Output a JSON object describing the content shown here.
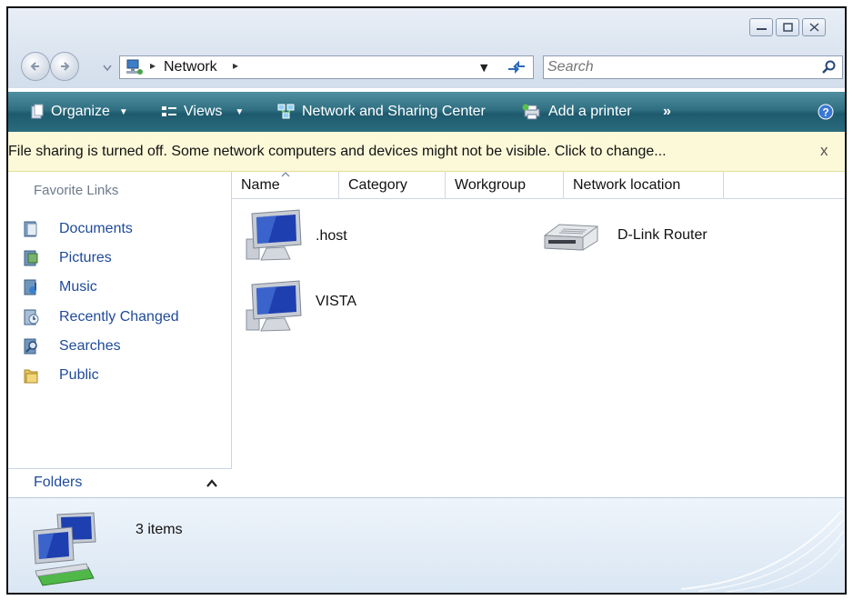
{
  "address": {
    "segment": "Network"
  },
  "search": {
    "placeholder": "Search"
  },
  "toolbar": {
    "organize": "Organize",
    "views": "Views",
    "network_center": "Network and Sharing Center",
    "add_printer": "Add a printer",
    "more": "»"
  },
  "infobar": {
    "message": "File sharing is turned off. Some network computers and devices might not be visible. Click to change...",
    "close": "x"
  },
  "left_pane": {
    "title": "Favorite Links",
    "links": [
      {
        "label": "Documents",
        "icon": "documents-icon"
      },
      {
        "label": "Pictures",
        "icon": "pictures-icon"
      },
      {
        "label": "Music",
        "icon": "music-icon"
      },
      {
        "label": "Recently Changed",
        "icon": "recently-changed-icon"
      },
      {
        "label": "Searches",
        "icon": "searches-icon"
      },
      {
        "label": "Public",
        "icon": "public-folder-icon"
      }
    ],
    "folders_label": "Folders"
  },
  "columns": [
    "Name",
    "Category",
    "Workgroup",
    "Network location"
  ],
  "items": [
    {
      "label": ".host",
      "icon": "computer-icon"
    },
    {
      "label": "D-Link Router",
      "icon": "router-icon"
    },
    {
      "label": "VISTA",
      "icon": "computer-icon"
    }
  ],
  "details": {
    "count": "3 items"
  },
  "colors": {
    "command_bar": "#2f6f82",
    "link": "#1e4a9a",
    "infobar": "#fcf9d9"
  }
}
